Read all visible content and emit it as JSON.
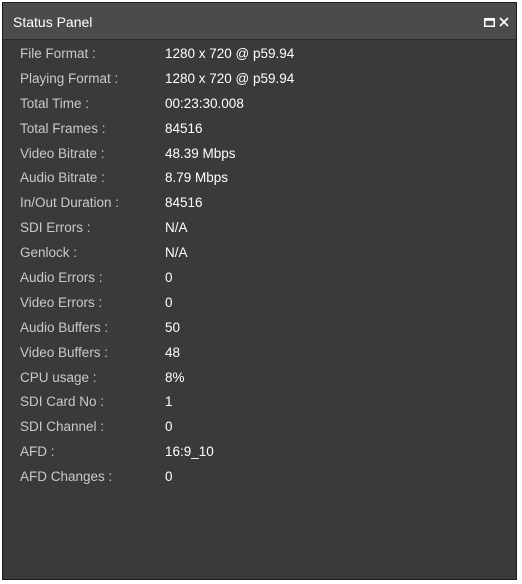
{
  "panel": {
    "title": "Status Panel",
    "background_color": "#3a3a3a",
    "titlebar_color": "#4b4b4b",
    "buttons": [
      "restore-icon",
      "close-icon"
    ]
  },
  "rows": [
    {
      "label": "File Format :",
      "value": "1280 x 720 @ p59.94"
    },
    {
      "label": "Playing Format :",
      "value": "1280 x 720 @ p59.94"
    },
    {
      "label": "Total Time :",
      "value": "00:23:30.008"
    },
    {
      "label": "Total Frames :",
      "value": "84516"
    },
    {
      "label": "Video Bitrate :",
      "value": "48.39 Mbps"
    },
    {
      "label": "Audio Bitrate :",
      "value": "8.79 Mbps"
    },
    {
      "label": "In/Out Duration :",
      "value": "84516"
    },
    {
      "label": "SDI Errors :",
      "value": "N/A"
    },
    {
      "label": "Genlock :",
      "value": "N/A"
    },
    {
      "label": "Audio Errors :",
      "value": "0"
    },
    {
      "label": "Video Errors :",
      "value": "0"
    },
    {
      "label": "Audio Buffers :",
      "value": "50"
    },
    {
      "label": "Video Buffers :",
      "value": "48"
    },
    {
      "label": "CPU usage :",
      "value": "8%"
    },
    {
      "label": "SDI Card No :",
      "value": "1"
    },
    {
      "label": "SDI Channel :",
      "value": "0"
    },
    {
      "label": "AFD :",
      "value": "16:9_10"
    },
    {
      "label": "AFD Changes :",
      "value": "0"
    }
  ]
}
